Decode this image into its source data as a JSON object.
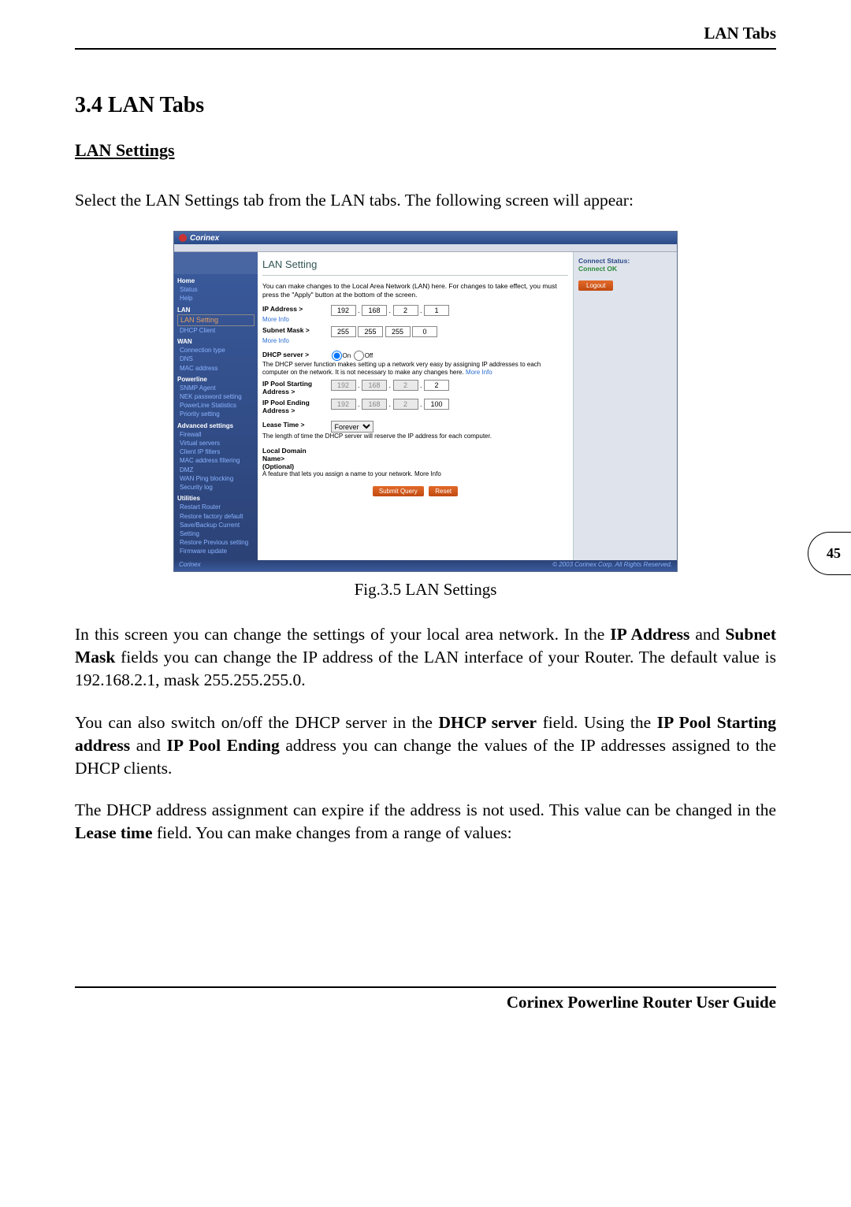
{
  "header": {
    "title": "LAN Tabs"
  },
  "section": {
    "heading": "3.4 LAN Tabs",
    "subheading": "LAN Settings",
    "intro": "Select the LAN Settings tab from the LAN tabs. The following screen will appear:"
  },
  "figure": {
    "caption": "Fig.3.5 LAN Settings"
  },
  "paragraphs": {
    "p1a": "In this screen you can change the settings of your local area network. In the ",
    "p1b": "IP Address",
    "p1c": " and ",
    "p1d": "Subnet Mask",
    "p1e": " fields you can change the IP address of the LAN interface of your Router. The default value is 192.168.2.1, mask 255.255.255.0.",
    "p2a": "You can also switch on/off the DHCP server in the ",
    "p2b": "DHCP server",
    "p2c": " field. Using the ",
    "p2d": "IP Pool Starting address",
    "p2e": " and ",
    "p2f": "IP Pool Ending",
    "p2g": " address you can change the values of the IP addresses assigned to the DHCP clients.",
    "p3a": "The DHCP address assignment can expire if the address is not used. This value can be changed in the ",
    "p3b": "Lease time",
    "p3c": " field. You can make changes from a range of values:"
  },
  "pagenum": "45",
  "footer": "Corinex Powerline Router User Guide",
  "shot": {
    "brand": "Corinex",
    "nav": {
      "home": "Home",
      "status": "Status",
      "help": "Help",
      "lan": "LAN",
      "lan_setting": "LAN Setting",
      "dhcp_client": "DHCP Client",
      "wan": "WAN",
      "conn_type": "Connection type",
      "dns": "DNS",
      "mac_addr": "MAC address",
      "powerline": "Powerline",
      "snmp": "SNMP Agent",
      "nek": "NEK password setting",
      "pl_stats": "PowerLine Statistics",
      "priority": "Priority setting",
      "adv": "Advanced settings",
      "firewall": "Firewall",
      "vservers": "Virtual servers",
      "ipfilters": "Client IP filters",
      "macfilter": "MAC address filtering",
      "dmz": "DMZ",
      "wanping": "WAN Ping blocking",
      "seclog": "Security log",
      "util": "Utilities",
      "restart": "Restart Router",
      "factory": "Restore factory default",
      "savebak": "Save/Backup Current Setting",
      "restprev": "Restore Previous setting",
      "fw": "Firmware update"
    },
    "center": {
      "title": "LAN Setting",
      "intro": "You can make changes to the Local Area Network (LAN) here. For changes to take effect, you must press the \"Apply\" button at the bottom of the screen.",
      "ip_label": "IP Address >",
      "more_info": "More Info",
      "subnet_label": "Subnet Mask >",
      "dhcp_label": "DHCP server >",
      "on": "On",
      "off": "Off",
      "dhcp_desc1": "The DHCP server function makes setting up a network very easy by assigning IP addresses to each computer on the network. It is not necessary to make any changes here.",
      "pool_start": "IP Pool Starting Address >",
      "pool_end": "IP Pool Ending Address >",
      "lease_label": "Lease Time >",
      "lease_val": "Forever",
      "lease_desc": "The length of time the DHCP server will reserve the IP address for each computer.",
      "domain_label": "Local Domain Name>",
      "optional": "(Optional)",
      "domain_desc": "A feature that lets you assign a name to your network. More Info",
      "submit": "Submit Query",
      "reset": "Reset",
      "ip": [
        "192",
        "168",
        "2",
        "1"
      ],
      "mask": [
        "255",
        "255",
        "255",
        "0"
      ],
      "pstart": [
        "192",
        "168",
        "2",
        "2"
      ],
      "pend": [
        "192",
        "168",
        "2",
        "100"
      ]
    },
    "right": {
      "status_lbl": "Connect Status:",
      "status_val": "Connect OK",
      "logout": "Logout"
    },
    "copyright": "© 2003 Corinex Corp. All Rights Reserved."
  }
}
